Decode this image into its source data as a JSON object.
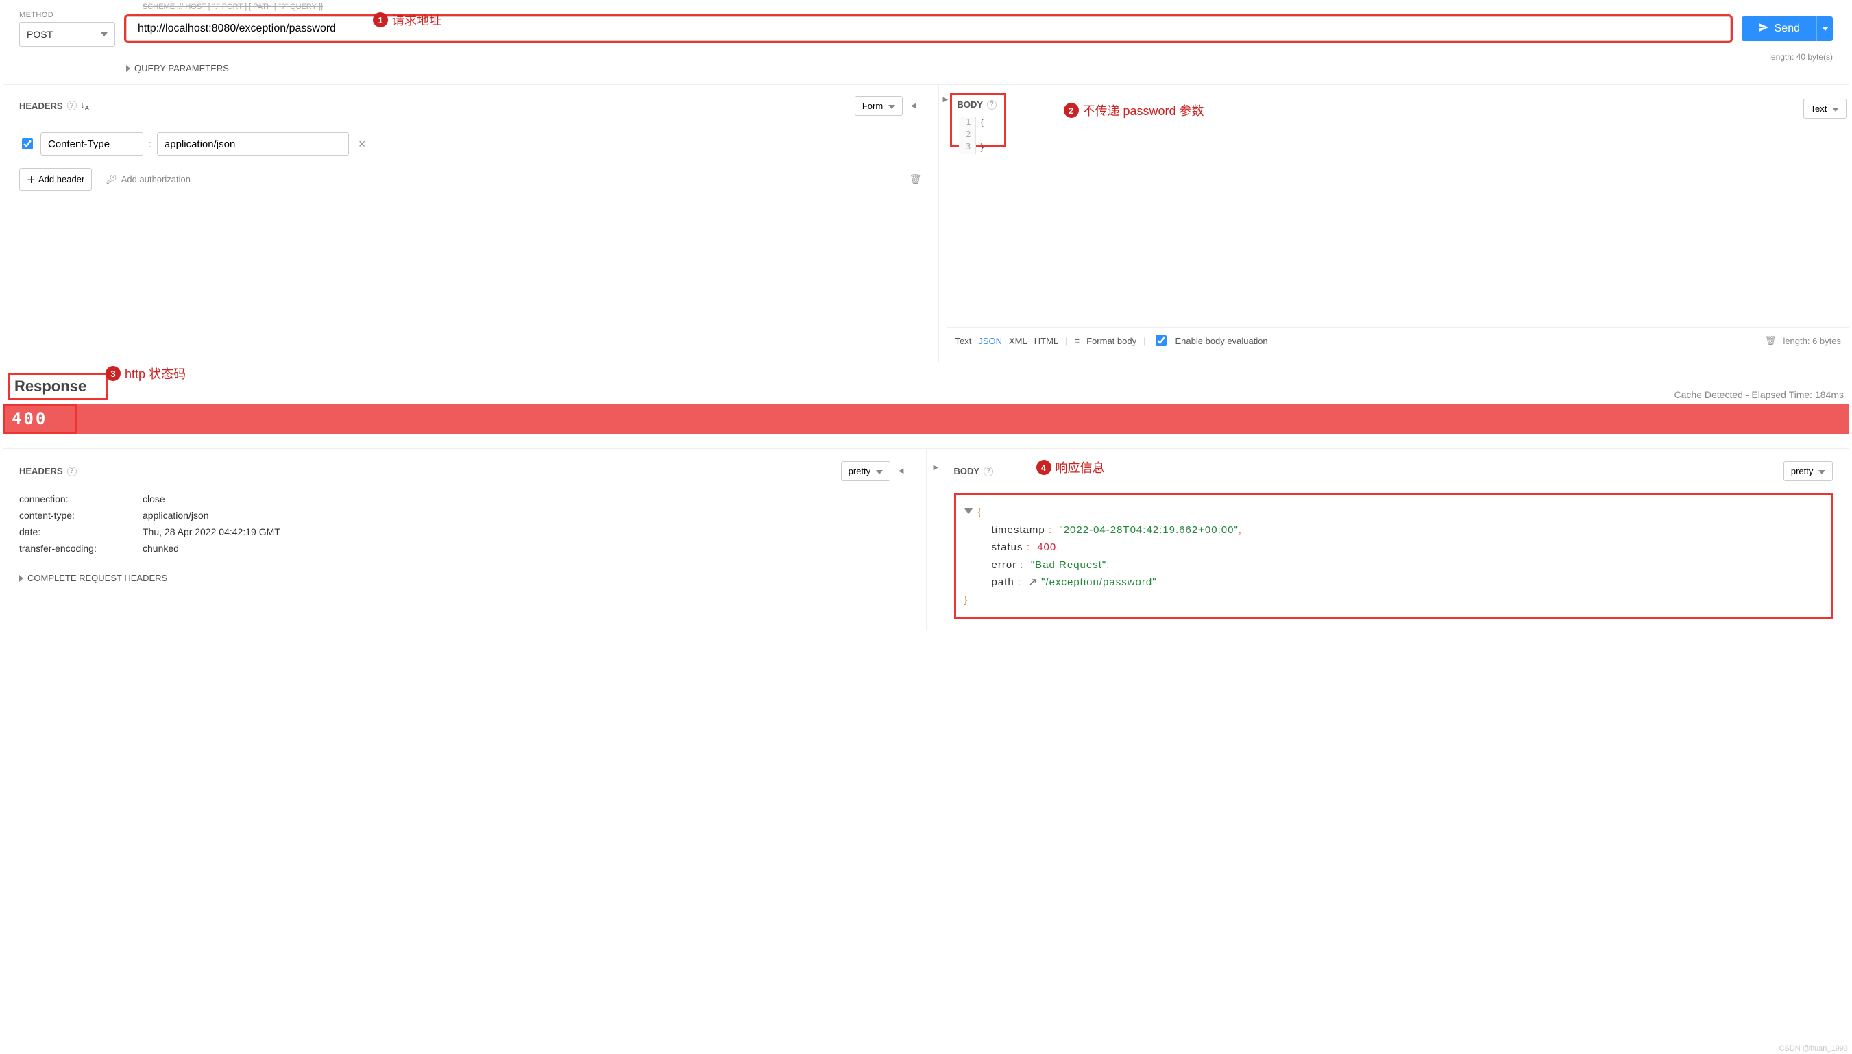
{
  "method": {
    "label": "METHOD",
    "value": "POST"
  },
  "url": {
    "overlabel": "SCHEME :// HOST [ \":\" PORT ] [ PATH [ \"?\" QUERY ]]",
    "value": "http://localhost:8080/exception/password",
    "length_text": "length: 40 byte(s)"
  },
  "send": {
    "label": "Send"
  },
  "query_params": {
    "label": "QUERY PARAMETERS"
  },
  "headers_panel": {
    "title": "HEADERS",
    "form_btn": "Form",
    "rows": [
      {
        "name": "Content-Type",
        "value": "application/json"
      }
    ],
    "add_header": "Add header",
    "add_auth": "Add authorization"
  },
  "body_panel": {
    "title": "BODY",
    "text_btn": "Text",
    "code_lines": [
      "{",
      "",
      "}"
    ],
    "footer": {
      "types": [
        "Text",
        "JSON",
        "XML",
        "HTML"
      ],
      "active": "JSON",
      "format": "Format body",
      "enable": "Enable body evaluation",
      "length": "length: 6 bytes"
    }
  },
  "annotations": {
    "a1": "请求地址",
    "a2": "不传递 password 参数",
    "a3": "http 状态码",
    "a4": "响应信息"
  },
  "response": {
    "title": "Response",
    "cache": "Cache Detected - Elapsed Time: 184ms",
    "status_code": "400",
    "headers_panel": {
      "title": "HEADERS",
      "pretty": "pretty",
      "rows": [
        {
          "k": "connection:",
          "v": "close"
        },
        {
          "k": "content-type:",
          "v": "application/json"
        },
        {
          "k": "date:",
          "v": "Thu, 28 Apr 2022 04:42:19 GMT"
        },
        {
          "k": "transfer-encoding:",
          "v": "chunked"
        }
      ],
      "complete": "COMPLETE REQUEST HEADERS"
    },
    "body_panel": {
      "title": "BODY",
      "pretty": "pretty",
      "json": {
        "timestamp": "\"2022-04-28T04:42:19.662+00:00\"",
        "status": "400",
        "error": "\"Bad Request\"",
        "path": "\"/exception/password\""
      }
    }
  },
  "watermark": "CSDN @huan_1993"
}
